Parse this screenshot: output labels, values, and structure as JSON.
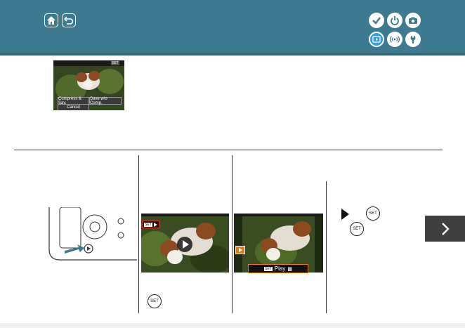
{
  "header": {
    "nav_icons": [
      "home-icon",
      "back-icon"
    ],
    "category_icons": [
      "check-icon",
      "power-icon",
      "camera-icon",
      "playback-icon",
      "wireless-icon",
      "wrench-icon"
    ],
    "active_category": "playback-icon",
    "color": "#3e7a8f"
  },
  "preview_screen": {
    "buttons": {
      "compress": "Compress & Sav.",
      "save_without": "Save w/o Comp.",
      "cancel": "Cancel"
    },
    "badge": "SET"
  },
  "steps": {
    "screen1_badge": "SET",
    "screen2_bar_label": "Play",
    "screen2_bar_key": "SET",
    "set_key_label": "SET"
  },
  "next_button": {
    "icon": "chevron-right-icon"
  }
}
